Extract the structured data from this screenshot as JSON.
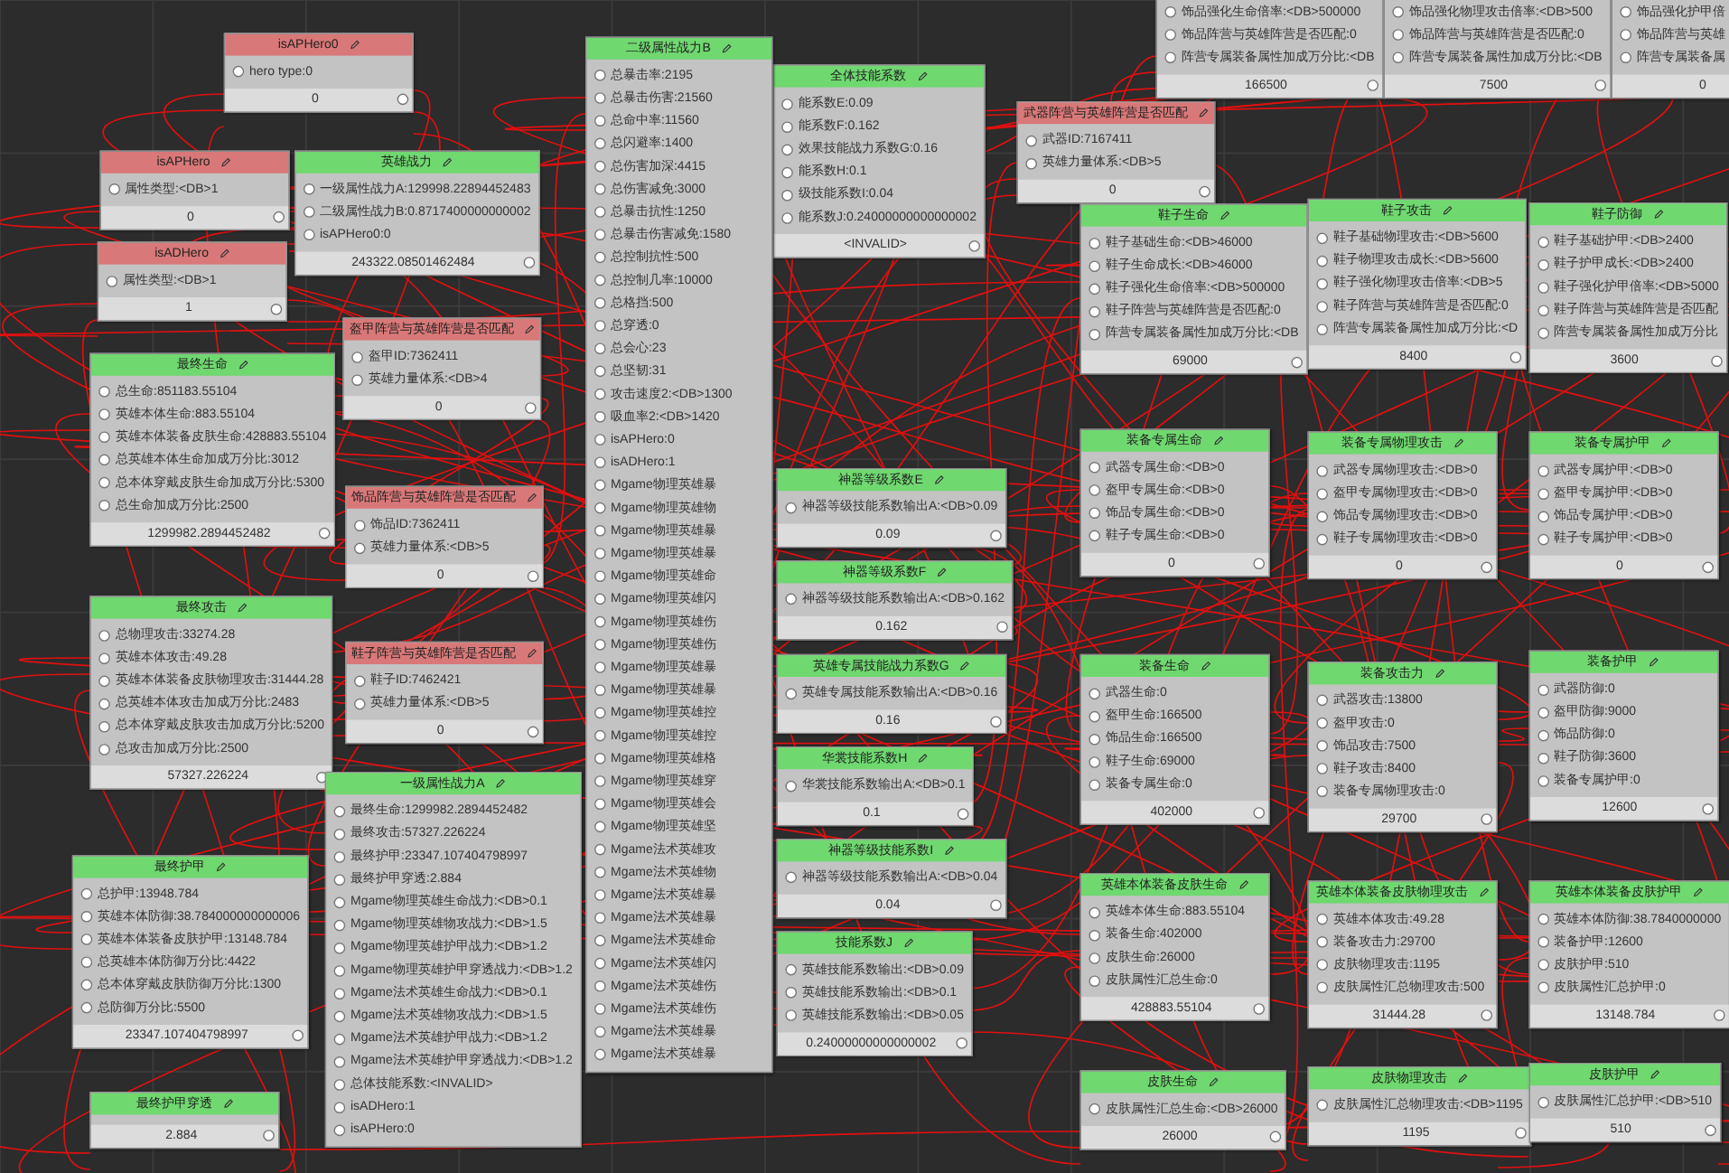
{
  "nodes": [
    {
      "kind": "check",
      "title": "isAPHero0",
      "rows": [
        "hero type:0"
      ],
      "output": "0"
    },
    {
      "kind": "check",
      "title": "isAPHero",
      "rows": [
        "属性类型:<DB>1"
      ],
      "output": "0"
    },
    {
      "kind": "check",
      "title": "isADHero",
      "rows": [
        "属性类型:<DB>1"
      ],
      "output": "1"
    },
    {
      "kind": "calc",
      "title": "英雄战力",
      "rows": [
        "一级属性战力A:129998.22894452483",
        "二级属性战力B:0.8717400000000002",
        "isAPHero0:0"
      ],
      "output": "243322.08501462484"
    },
    {
      "kind": "calc",
      "title": "最终生命",
      "rows": [
        "总生命:851183.55104",
        "英雄本体生命:883.55104",
        "英雄本体装备皮肤生命:428883.55104",
        "总英雄本体生命加成万分比:3012",
        "总本体穿戴皮肤生命加成万分比:5300",
        "总生命加成万分比:2500"
      ],
      "output": "1299982.2894452482"
    },
    {
      "kind": "check",
      "title": "盔甲阵营与英雄阵营是否匹配",
      "rows": [
        "盔甲ID:7362411",
        "英雄力量体系:<DB>4"
      ],
      "output": "0"
    },
    {
      "kind": "check",
      "title": "饰品阵营与英雄阵营是否匹配",
      "rows": [
        "饰品ID:7362411",
        "英雄力量体系:<DB>5"
      ],
      "output": "0"
    },
    {
      "kind": "calc",
      "title": "最终攻击",
      "rows": [
        "总物理攻击:33274.28",
        "英雄本体攻击:49.28",
        "英雄本体装备皮肤物理攻击:31444.28",
        "总英雄本体攻击加成万分比:2483",
        "总本体穿戴皮肤攻击加成万分比:5200",
        "总攻击加成万分比:2500"
      ],
      "output": "57327.226224"
    },
    {
      "kind": "check",
      "title": "鞋子阵营与英雄阵营是否匹配",
      "rows": [
        "鞋子ID:7462421",
        "英雄力量体系:<DB>5"
      ],
      "output": "0"
    },
    {
      "kind": "calc",
      "title": "最终护甲",
      "rows": [
        "总护甲:13948.784",
        "英雄本体防御:38.784000000000006",
        "英雄本体装备皮肤护甲:13148.784",
        "总英雄本体防御万分比:4422",
        "总本体穿戴皮肤防御万分比:1300",
        "总防御万分比:5500"
      ],
      "output": "23347.107404798997"
    },
    {
      "kind": "calc",
      "title": "最终护甲穿透",
      "output": "2.884"
    },
    {
      "kind": "calc",
      "title": "一级属性战力A",
      "rows": [
        "最终生命:1299982.2894452482",
        "最终攻击:57327.226224",
        "最终护甲:23347.107404798997",
        "最终护甲穿透:2.884",
        "Mgame物理英雄生命战力:<DB>0.1",
        "Mgame物理英雄物攻战力:<DB>1.5",
        "Mgame物理英雄护甲战力:<DB>1.2",
        "Mgame物理英雄护甲穿透战力:<DB>1.2",
        "Mgame法术英雄生命战力:<DB>0.1",
        "Mgame法术英雄物攻战力:<DB>1.5",
        "Mgame法术英雄护甲战力:<DB>1.2",
        "Mgame法术英雄护甲穿透战力:<DB>1.2",
        "总体技能系数:<INVALID>",
        "isADHero:1",
        "isAPHero:0"
      ]
    },
    {
      "kind": "calc",
      "title": "全体技能系数",
      "rows": [
        "能系数E:0.09",
        "能系数F:0.162",
        "效果技能战力系数G:0.16",
        "能系数H:0.1",
        "级技能系数I:0.04",
        "能系数J:0.24000000000000002"
      ],
      "output": "<INVALID>"
    },
    {
      "kind": "calc",
      "title": "二级属性战力B",
      "rows": [
        "总暴击率:2195",
        "总暴击伤害:21560",
        "总命中率:11560",
        "总闪避率:1400",
        "总伤害加深:4415",
        "总伤害减免:3000",
        "总暴击抗性:1250",
        "总暴击伤害减免:1580",
        "总控制抗性:500",
        "总控制几率:10000",
        "总格挡:500",
        "总穿透:0",
        "总会心:23",
        "总坚韧:31",
        "攻击速度2:<DB>1300",
        "吸血率2:<DB>1420",
        "isAPHero:0",
        "isADHero:1",
        "Mgame物理英雄暴",
        "Mgame物理英雄物",
        "Mgame物理英雄暴",
        "Mgame物理英雄暴",
        "Mgame物理英雄命",
        "Mgame物理英雄闪",
        "Mgame物理英雄伤",
        "Mgame物理英雄伤",
        "Mgame物理英雄暴",
        "Mgame物理英雄暴",
        "Mgame物理英雄控",
        "Mgame物理英雄控",
        "Mgame物理英雄格",
        "Mgame物理英雄穿",
        "Mgame物理英雄会",
        "Mgame物理英雄坚",
        "Mgame法术英雄攻",
        "Mgame法术英雄物",
        "Mgame法术英雄暴",
        "Mgame法术英雄暴",
        "Mgame法术英雄命",
        "Mgame法术英雄闪",
        "Mgame法术英雄伤",
        "Mgame法术英雄伤",
        "Mgame法术英雄暴",
        "Mgame法术英雄暴"
      ]
    },
    {
      "kind": "check",
      "title": "武器阵营与英雄阵营是否匹配",
      "rows": [
        "武器ID:7167411",
        "英雄力量体系:<DB>5"
      ],
      "output": "0"
    },
    {
      "kind": "calc",
      "title": "神器等级系数E",
      "rows": [
        "神器等级技能系数输出A:<DB>0.09"
      ],
      "output": "0.09"
    },
    {
      "kind": "calc",
      "title": "神器等级系数F",
      "rows": [
        "神器等级技能系数输出A:<DB>0.162"
      ],
      "output": "0.162"
    },
    {
      "kind": "calc",
      "title": "英雄专属技能战力系数G",
      "rows": [
        "英雄专属技能系数输出A:<DB>0.16"
      ],
      "output": "0.16"
    },
    {
      "kind": "calc",
      "title": "华裳技能系数H",
      "rows": [
        "华裳技能系数输出A:<DB>0.1"
      ],
      "output": "0.1"
    },
    {
      "kind": "calc",
      "title": "神器等级技能系数I",
      "rows": [
        "神器等级技能系数输出A:<DB>0.04"
      ],
      "output": "0.04"
    },
    {
      "kind": "calc",
      "title": "技能系数J",
      "rows": [
        "英雄技能系数输出:<DB>0.09",
        "英雄技能系数输出:<DB>0.1",
        "英雄技能系数输出:<DB>0.05"
      ],
      "output": "0.24000000000000002"
    },
    {
      "rows": [
        "饰品强化生命倍率:<DB>500000",
        "饰品阵营与英雄阵营是否匹配:0",
        "阵营专属装备属性加成万分比:<DB"
      ],
      "output": "166500"
    },
    {
      "rows": [
        "饰品强化物理攻击倍率:<DB>500",
        "饰品阵营与英雄阵营是否匹配:0",
        "阵营专属装备属性加成万分比:<DB"
      ],
      "output": "7500"
    },
    {
      "rows": [
        "饰品强化护甲倍",
        "饰品阵营与英雄",
        "阵营专属装备属"
      ],
      "output": "0"
    },
    {
      "kind": "calc",
      "title": "鞋子生命",
      "rows": [
        "鞋子基础生命:<DB>46000",
        "鞋子生命成长:<DB>46000",
        "鞋子强化生命倍率:<DB>500000",
        "鞋子阵营与英雄阵营是否匹配:0",
        "阵营专属装备属性加成万分比:<DB"
      ],
      "output": "69000"
    },
    {
      "kind": "calc",
      "title": "鞋子攻击",
      "rows": [
        "鞋子基础物理攻击:<DB>5600",
        "鞋子物理攻击成长:<DB>5600",
        "鞋子强化物理攻击倍率:<DB>5",
        "鞋子阵营与英雄阵营是否匹配:0",
        "阵营专属装备属性加成万分比:<D"
      ],
      "output": "8400"
    },
    {
      "kind": "calc",
      "title": "鞋子防御",
      "rows": [
        "鞋子基础护甲:<DB>2400",
        "鞋子护甲成长:<DB>2400",
        "鞋子强化护甲倍率:<DB>5000",
        "鞋子阵营与英雄阵营是否匹配",
        "阵营专属装备属性加成万分比"
      ],
      "output": "3600"
    },
    {
      "kind": "calc",
      "title": "装备专属生命",
      "rows": [
        "武器专属生命:<DB>0",
        "盔甲专属生命:<DB>0",
        "饰品专属生命:<DB>0",
        "鞋子专属生命:<DB>0"
      ],
      "output": "0"
    },
    {
      "kind": "calc",
      "title": "装备专属物理攻击",
      "rows": [
        "武器专属物理攻击:<DB>0",
        "盔甲专属物理攻击:<DB>0",
        "饰品专属物理攻击:<DB>0",
        "鞋子专属物理攻击:<DB>0"
      ],
      "output": "0"
    },
    {
      "kind": "calc",
      "title": "装备专属护甲",
      "rows": [
        "武器专属护甲:<DB>0",
        "盔甲专属护甲:<DB>0",
        "饰品专属护甲:<DB>0",
        "鞋子专属护甲:<DB>0"
      ],
      "output": "0"
    },
    {
      "kind": "calc",
      "title": "装备生命",
      "rows": [
        "武器生命:0",
        "盔甲生命:166500",
        "饰品生命:166500",
        "鞋子生命:69000",
        "装备专属生命:0"
      ],
      "output": "402000"
    },
    {
      "kind": "calc",
      "title": "装备攻击力",
      "rows": [
        "武器攻击:13800",
        "盔甲攻击:0",
        "饰品攻击:7500",
        "鞋子攻击:8400",
        "装备专属物理攻击:0"
      ],
      "output": "29700"
    },
    {
      "kind": "calc",
      "title": "装备护甲",
      "rows": [
        "武器防御:0",
        "盔甲防御:9000",
        "饰品防御:0",
        "鞋子防御:3600",
        "装备专属护甲:0"
      ],
      "output": "12600"
    },
    {
      "kind": "calc",
      "title": "英雄本体装备皮肤生命",
      "rows": [
        "英雄本体生命:883.55104",
        "装备生命:402000",
        "皮肤生命:26000",
        "皮肤属性汇总生命:0"
      ],
      "output": "428883.55104"
    },
    {
      "kind": "calc",
      "title": "英雄本体装备皮肤物理攻击",
      "rows": [
        "英雄本体攻击:49.28",
        "装备攻击力:29700",
        "皮肤物理攻击:1195",
        "皮肤属性汇总物理攻击:500"
      ],
      "output": "31444.28"
    },
    {
      "kind": "calc",
      "title": "英雄本体装备皮肤护甲",
      "rows": [
        "英雄本体防御:38.7840000000",
        "装备护甲:12600",
        "皮肤护甲:510",
        "皮肤属性汇总护甲:0"
      ],
      "output": "13148.784"
    },
    {
      "kind": "calc",
      "title": "皮肤生命",
      "rows": [
        "皮肤属性汇总生命:<DB>26000"
      ],
      "output": "26000"
    },
    {
      "kind": "calc",
      "title": "皮肤物理攻击",
      "rows": [
        "皮肤属性汇总物理攻击:<DB>1195"
      ],
      "output": "1195"
    },
    {
      "kind": "calc",
      "title": "皮肤护甲",
      "rows": [
        "皮肤属性汇总护甲:<DB>510"
      ],
      "output": "510"
    }
  ]
}
